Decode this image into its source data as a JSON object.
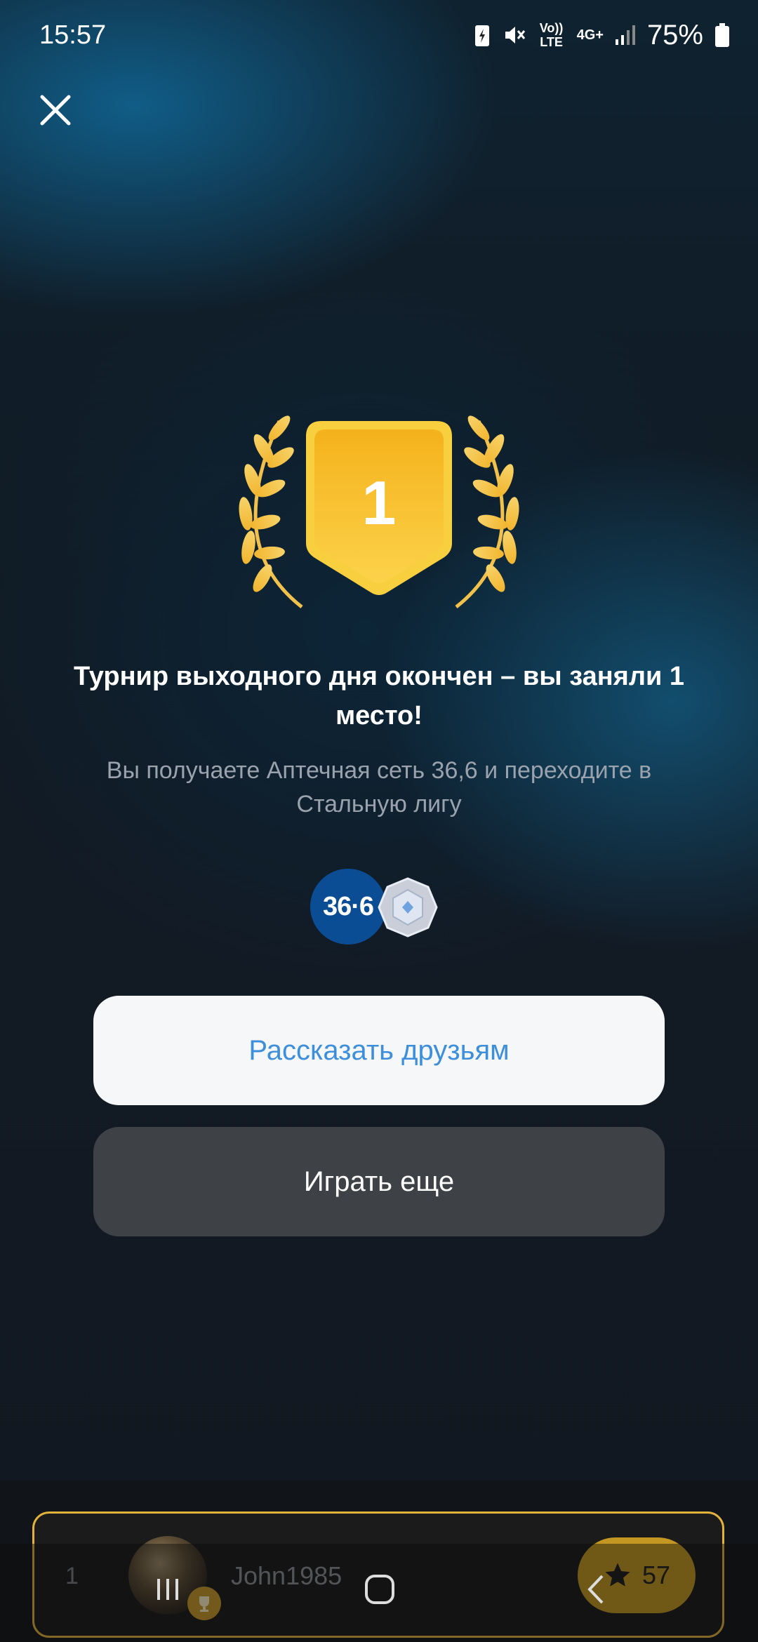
{
  "status_bar": {
    "time": "15:57",
    "network_label": "Vo)) LTE",
    "network_gen": "4G+",
    "battery": "75%"
  },
  "close_icon": "close-icon",
  "trophy": {
    "place": "1"
  },
  "result": {
    "title": "Турнир выходного дня окончен – вы заняли 1 место!",
    "subtitle": "Вы получаете Аптечная сеть 36,6 и переходите в Стальную лигу"
  },
  "rewards": {
    "partner_logo_text": "36·6"
  },
  "buttons": {
    "share": "Рассказать друзьям",
    "play_again": "Играть еще"
  },
  "player": {
    "rank": "1",
    "name": "John1985",
    "score": "57"
  },
  "colors": {
    "accent_gold": "#e3b23c",
    "share_text": "#3d8edb",
    "partner_blue": "#0b4d95"
  }
}
